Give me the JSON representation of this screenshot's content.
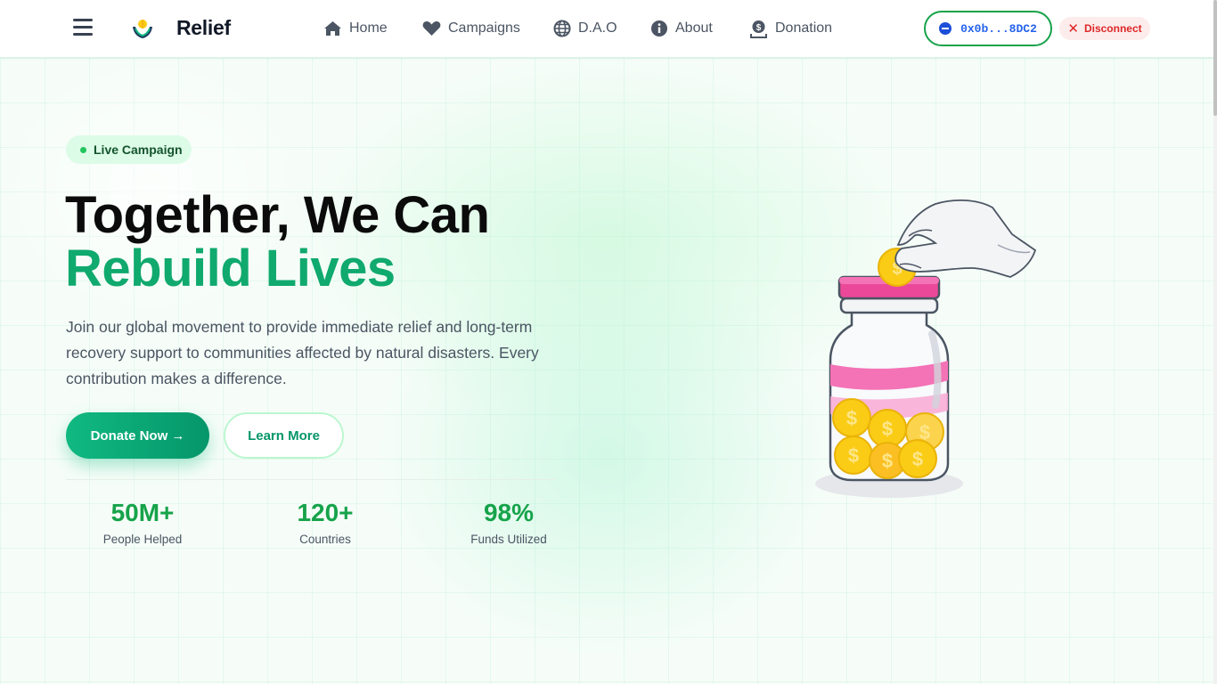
{
  "header": {
    "brand": "Relief",
    "nav": [
      {
        "label": "Home",
        "icon": "home-icon"
      },
      {
        "label": "Campaigns",
        "icon": "heart-icon"
      },
      {
        "label": "D.A.O",
        "icon": "globe-icon"
      },
      {
        "label": "About",
        "icon": "info-icon"
      },
      {
        "label": "Donation",
        "icon": "donation-icon"
      }
    ],
    "wallet_address": "0x0b...8DC2",
    "disconnect_label": "Disconnect"
  },
  "hero": {
    "badge": "Live Campaign",
    "title_line1": "Together, We Can",
    "title_line2": "Rebuild Lives",
    "subtitle": "Join our global movement to provide immediate relief and long-term recovery support to communities affected by natural disasters. Every contribution makes a difference.",
    "donate_label": "Donate Now →",
    "learn_label": "Learn More",
    "stats": [
      {
        "value": "50M+",
        "label": "People Helped"
      },
      {
        "value": "120+",
        "label": "Countries"
      },
      {
        "value": "98%",
        "label": "Funds Utilized"
      }
    ]
  },
  "colors": {
    "accent": "#10b981",
    "accent_dark": "#059669",
    "stat_green": "#16a34a",
    "disconnect_red": "#dc2626",
    "wallet_blue": "#2563eb"
  }
}
